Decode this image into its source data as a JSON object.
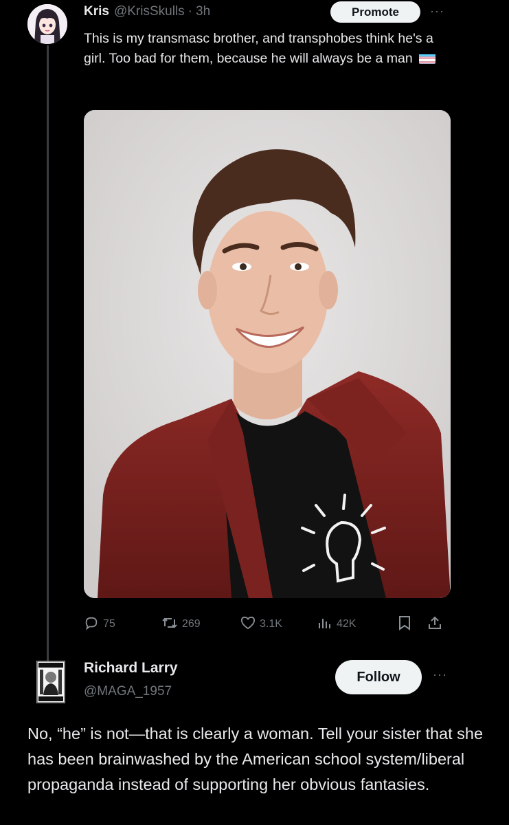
{
  "post": {
    "author_name": "Kris",
    "author_handle": "@KrisSkulls",
    "separator": "·",
    "timestamp": "3h",
    "promote_label": "Promote",
    "more_label": "···",
    "text": "This is my transmasc brother, and transphobes think he's a girl. Too bad for them, because he will always be a man",
    "flag_icon": "transgender-flag-icon",
    "stats": {
      "replies": "75",
      "reposts": "269",
      "likes": "3.1K",
      "views": "42K"
    }
  },
  "reply": {
    "author_name": "Richard Larry",
    "author_handle": "@MAGA_1957",
    "follow_label": "Follow",
    "more_label": "···",
    "text": "No, “he” is not—that is clearly a woman. Tell your sister that she has been brainwashed by the American school system/liberal propaganda instead of supporting her obvious fantasies."
  },
  "colors": {
    "background": "#000000",
    "text_primary": "#e7e9ea",
    "text_secondary": "#71767b",
    "button_bg": "#eff3f4",
    "flag_blue": "#5bcefa",
    "flag_pink": "#f5a9b8"
  }
}
